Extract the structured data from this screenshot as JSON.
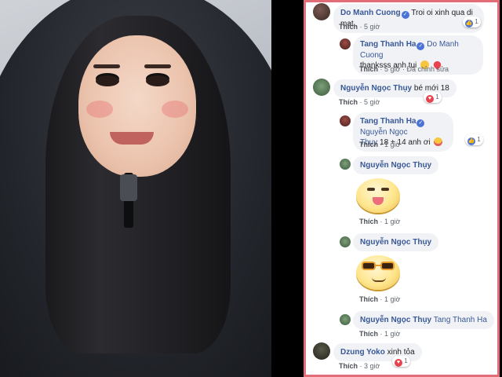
{
  "comments": [
    {
      "author": "Do Manh Cuong",
      "verified": true,
      "text": "Troi oi xinh qua di mat",
      "meta": {
        "like": "Thích",
        "time": "5 giờ"
      },
      "reaction": {
        "type": "like",
        "count": "1"
      }
    },
    {
      "author": "Tang Thanh Ha",
      "verified": true,
      "mention": "Do Manh Cuong",
      "text": "thanksss anh tui",
      "emoji": [
        "smile",
        "heart"
      ],
      "meta": {
        "like": "Thích",
        "time": "5 giờ",
        "edited": "Đã chỉnh sửa"
      }
    },
    {
      "author": "Nguyễn Ngọc Thụy",
      "text": "bé mới 18",
      "meta": {
        "like": "Thích",
        "time": "5 giờ"
      },
      "reaction": {
        "type": "love",
        "count": "1"
      }
    },
    {
      "author": "Tang Thanh Ha",
      "verified": true,
      "mention": "Nguyễn Ngọc",
      "mention_cont": "Thụy",
      "text": "18 + 14 anh ơi",
      "emoji": [
        "lol"
      ],
      "meta": {
        "like": "Thích",
        "time": "1 giờ"
      },
      "reaction": {
        "type": "like",
        "count": "1"
      }
    },
    {
      "author": "Nguyễn Ngọc Thụy",
      "sticker": "tongue-face-sticker",
      "meta": {
        "like": "Thích",
        "time": "1 giờ"
      }
    },
    {
      "author": "Nguyễn Ngọc Thụy",
      "sticker": "sunglasses-face-sticker",
      "meta": {
        "like": "Thích",
        "time": "1 giờ"
      }
    },
    {
      "author": "Nguyễn Ngọc Thụy",
      "mention": "Tang Thanh Ha",
      "meta": {
        "like": "Thích",
        "time": "1 giờ"
      }
    },
    {
      "author": "Dzung Yoko",
      "text": "xinh tỏa",
      "meta": {
        "like": "Thích",
        "time": "3 giờ"
      },
      "reaction": {
        "type": "love",
        "count": "1"
      }
    }
  ],
  "separator": "·",
  "colors": {
    "panel_border": "#e26d78",
    "author": "#385898",
    "bubble": "#f1f2f5",
    "like_reaction": "#4b73d6",
    "love_reaction": "#e8424f"
  }
}
